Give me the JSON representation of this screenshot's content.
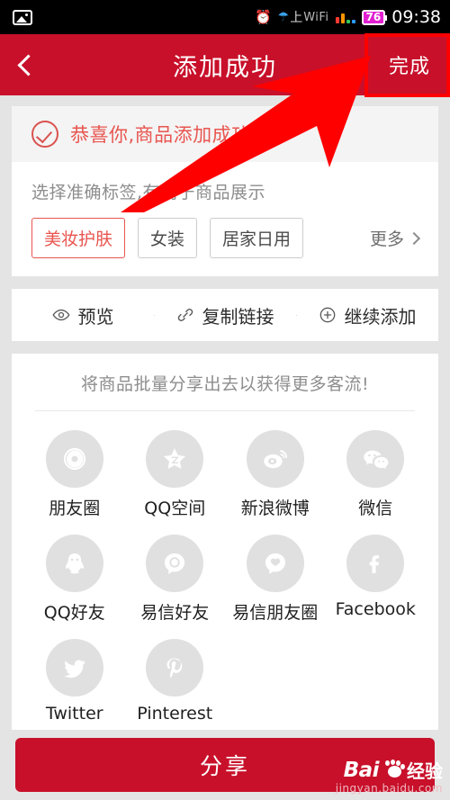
{
  "statusbar": {
    "photo_icon": "photo-icon",
    "alarm_icon": "alarm-clock-icon",
    "wifi_glyph": "wifi-robot-icon",
    "wifi_cn": "上",
    "wifi_en": "WiFi",
    "battery_level": "76",
    "time": "09:38"
  },
  "header": {
    "back_icon": "chevron-left-icon",
    "title": "添加成功",
    "done_label": "完成",
    "bg_color": "#c8102a"
  },
  "success": {
    "check_icon": "check-circle-icon",
    "message": "恭喜你,商品添加成功!",
    "accent_color": "#e8554f"
  },
  "tags": {
    "hint": "选择准确标签,有利于商品展示",
    "items": [
      {
        "label": "美妆护肤",
        "selected": true
      },
      {
        "label": "女装",
        "selected": false
      },
      {
        "label": "居家日用",
        "selected": false
      }
    ],
    "more_label": "更多",
    "more_icon": "chevron-right-icon"
  },
  "actions": [
    {
      "icon": "eye-icon",
      "label": "预览"
    },
    {
      "icon": "link-icon",
      "label": "复制链接"
    },
    {
      "icon": "plus-circle-icon",
      "label": "继续添加"
    }
  ],
  "share": {
    "hint": "将商品批量分享出去以获得更多客流!",
    "items": [
      {
        "icon": "moments-aperture-icon",
        "label": "朋友圈"
      },
      {
        "icon": "qzone-star-icon",
        "label": "QQ空间"
      },
      {
        "icon": "weibo-icon",
        "label": "新浪微博"
      },
      {
        "icon": "wechat-icon",
        "label": "微信"
      },
      {
        "icon": "qq-penguin-icon",
        "label": "QQ好友"
      },
      {
        "icon": "yixin-friend-icon",
        "label": "易信好友"
      },
      {
        "icon": "yixin-moments-icon",
        "label": "易信朋友圈"
      },
      {
        "icon": "facebook-icon",
        "label": "Facebook"
      },
      {
        "icon": "twitter-icon",
        "label": "Twitter"
      },
      {
        "icon": "pinterest-icon",
        "label": "Pinterest"
      }
    ]
  },
  "bottom": {
    "share_label": "分享",
    "button_color": "#c8102a"
  },
  "annotation": {
    "box_color": "#ff0000",
    "arrow_color": "#ff0000"
  },
  "watermark": {
    "brand": "Bai",
    "paw_icon": "baidu-paw-icon",
    "suffix": "经验",
    "url": "jingyan.baidu.com"
  }
}
